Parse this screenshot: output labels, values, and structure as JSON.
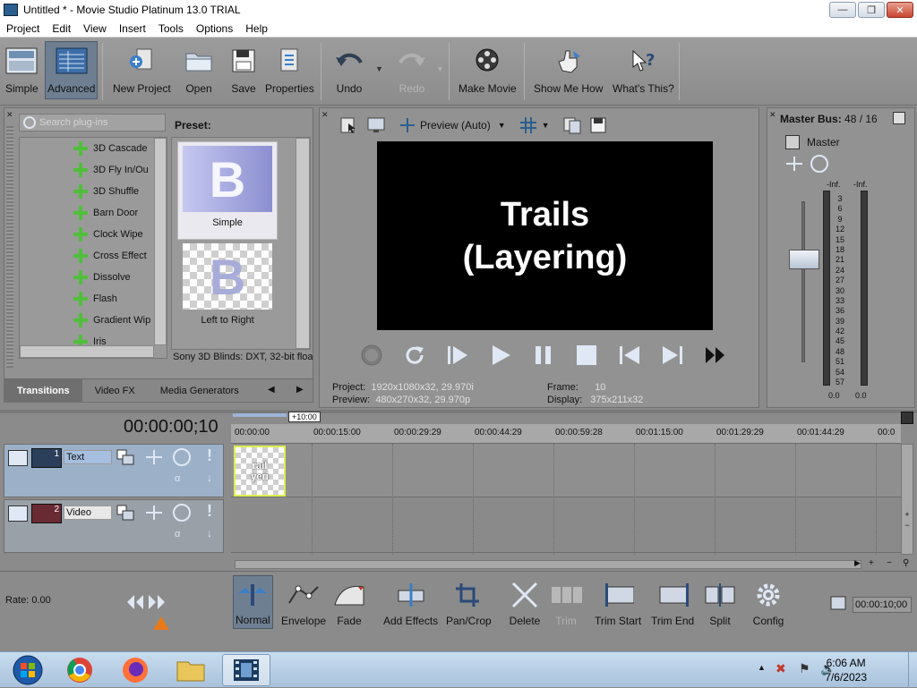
{
  "window": {
    "title": "Untitled * - Movie Studio Platinum 13.0 TRIAL"
  },
  "menu": [
    "Project",
    "Edit",
    "View",
    "Insert",
    "Tools",
    "Options",
    "Help"
  ],
  "toolbar": {
    "simple": "Simple",
    "advanced": "Advanced",
    "new_project": "New Project",
    "open": "Open",
    "save": "Save",
    "properties": "Properties",
    "undo": "Undo",
    "redo": "Redo",
    "make_movie": "Make Movie",
    "show_me_how": "Show Me How",
    "whats_this": "What's This?"
  },
  "plugins": {
    "search_placeholder": "Search plug-ins",
    "items": [
      "3D Cascade",
      "3D Fly In/Ou",
      "3D Shuffle",
      "Barn Door",
      "Clock Wipe",
      "Cross Effect",
      "Dissolve",
      "Flash",
      "Gradient Wip",
      "Iris"
    ],
    "preset_label": "Preset:",
    "presets": [
      "Simple",
      "Left to Right"
    ],
    "preset_glyph": "B",
    "preset_desc": "Sony 3D Blinds: DXT, 32-bit floa",
    "tabs": [
      "Transitions",
      "Video FX",
      "Media Generators"
    ]
  },
  "preview": {
    "mode": "Preview (Auto)",
    "screen_line1": "Trails",
    "screen_line2": "(Layering)",
    "project_label": "Project:",
    "project_value": "1920x1080x32, 29.970i",
    "preview_label": "Preview:",
    "preview_value": "480x270x32, 29.970p",
    "frame_label": "Frame:",
    "frame_value": "10",
    "display_label": "Display:",
    "display_value": "375x211x32"
  },
  "master": {
    "title": "Master Bus:",
    "value": "48 / 16",
    "name": "Master",
    "left_inf": "-Inf.",
    "right_inf": "-Inf.",
    "scale": [
      "3",
      "6",
      "9",
      "12",
      "15",
      "18",
      "21",
      "24",
      "27",
      "30",
      "33",
      "36",
      "39",
      "42",
      "45",
      "48",
      "51",
      "54",
      "57"
    ],
    "bottom_left": "0.0",
    "bottom_right": "0.0"
  },
  "timeline": {
    "timecode": "00:00:00;10",
    "offset": "+10:00",
    "ruler": [
      "00:00:00",
      "00:00:15:00",
      "00:00:29:29",
      "00:00:44:29",
      "00:00:59:28",
      "00:01:15:00",
      "00:01:29:29",
      "00:01:44:29",
      "00:0"
    ],
    "tracks": [
      {
        "num": "1",
        "name": "Text"
      },
      {
        "num": "2",
        "name": "Video"
      }
    ],
    "clip_text": "rail yeri"
  },
  "edit": {
    "rate": "Rate: 0.00",
    "normal": "Normal",
    "envelope": "Envelope",
    "fade": "Fade",
    "add_effects": "Add Effects",
    "pan_crop": "Pan/Crop",
    "delete": "Delete",
    "trim": "Trim",
    "trim_start": "Trim Start",
    "trim_end": "Trim End",
    "split": "Split",
    "config": "Config",
    "end_time": "00:00:10;00"
  },
  "taskbar": {
    "time": "6:06 AM",
    "date": "7/6/2023"
  }
}
